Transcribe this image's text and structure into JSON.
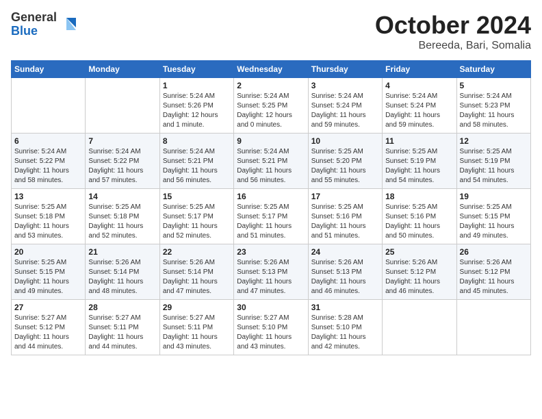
{
  "header": {
    "logo": {
      "general": "General",
      "blue": "Blue"
    },
    "title": "October 2024",
    "subtitle": "Bereeda, Bari, Somalia"
  },
  "weekdays": [
    "Sunday",
    "Monday",
    "Tuesday",
    "Wednesday",
    "Thursday",
    "Friday",
    "Saturday"
  ],
  "weeks": [
    [
      {
        "day": "",
        "info": ""
      },
      {
        "day": "",
        "info": ""
      },
      {
        "day": "1",
        "info": "Sunrise: 5:24 AM\nSunset: 5:26 PM\nDaylight: 12 hours\nand 1 minute."
      },
      {
        "day": "2",
        "info": "Sunrise: 5:24 AM\nSunset: 5:25 PM\nDaylight: 12 hours\nand 0 minutes."
      },
      {
        "day": "3",
        "info": "Sunrise: 5:24 AM\nSunset: 5:24 PM\nDaylight: 11 hours\nand 59 minutes."
      },
      {
        "day": "4",
        "info": "Sunrise: 5:24 AM\nSunset: 5:24 PM\nDaylight: 11 hours\nand 59 minutes."
      },
      {
        "day": "5",
        "info": "Sunrise: 5:24 AM\nSunset: 5:23 PM\nDaylight: 11 hours\nand 58 minutes."
      }
    ],
    [
      {
        "day": "6",
        "info": "Sunrise: 5:24 AM\nSunset: 5:22 PM\nDaylight: 11 hours\nand 58 minutes."
      },
      {
        "day": "7",
        "info": "Sunrise: 5:24 AM\nSunset: 5:22 PM\nDaylight: 11 hours\nand 57 minutes."
      },
      {
        "day": "8",
        "info": "Sunrise: 5:24 AM\nSunset: 5:21 PM\nDaylight: 11 hours\nand 56 minutes."
      },
      {
        "day": "9",
        "info": "Sunrise: 5:24 AM\nSunset: 5:21 PM\nDaylight: 11 hours\nand 56 minutes."
      },
      {
        "day": "10",
        "info": "Sunrise: 5:25 AM\nSunset: 5:20 PM\nDaylight: 11 hours\nand 55 minutes."
      },
      {
        "day": "11",
        "info": "Sunrise: 5:25 AM\nSunset: 5:19 PM\nDaylight: 11 hours\nand 54 minutes."
      },
      {
        "day": "12",
        "info": "Sunrise: 5:25 AM\nSunset: 5:19 PM\nDaylight: 11 hours\nand 54 minutes."
      }
    ],
    [
      {
        "day": "13",
        "info": "Sunrise: 5:25 AM\nSunset: 5:18 PM\nDaylight: 11 hours\nand 53 minutes."
      },
      {
        "day": "14",
        "info": "Sunrise: 5:25 AM\nSunset: 5:18 PM\nDaylight: 11 hours\nand 52 minutes."
      },
      {
        "day": "15",
        "info": "Sunrise: 5:25 AM\nSunset: 5:17 PM\nDaylight: 11 hours\nand 52 minutes."
      },
      {
        "day": "16",
        "info": "Sunrise: 5:25 AM\nSunset: 5:17 PM\nDaylight: 11 hours\nand 51 minutes."
      },
      {
        "day": "17",
        "info": "Sunrise: 5:25 AM\nSunset: 5:16 PM\nDaylight: 11 hours\nand 51 minutes."
      },
      {
        "day": "18",
        "info": "Sunrise: 5:25 AM\nSunset: 5:16 PM\nDaylight: 11 hours\nand 50 minutes."
      },
      {
        "day": "19",
        "info": "Sunrise: 5:25 AM\nSunset: 5:15 PM\nDaylight: 11 hours\nand 49 minutes."
      }
    ],
    [
      {
        "day": "20",
        "info": "Sunrise: 5:25 AM\nSunset: 5:15 PM\nDaylight: 11 hours\nand 49 minutes."
      },
      {
        "day": "21",
        "info": "Sunrise: 5:26 AM\nSunset: 5:14 PM\nDaylight: 11 hours\nand 48 minutes."
      },
      {
        "day": "22",
        "info": "Sunrise: 5:26 AM\nSunset: 5:14 PM\nDaylight: 11 hours\nand 47 minutes."
      },
      {
        "day": "23",
        "info": "Sunrise: 5:26 AM\nSunset: 5:13 PM\nDaylight: 11 hours\nand 47 minutes."
      },
      {
        "day": "24",
        "info": "Sunrise: 5:26 AM\nSunset: 5:13 PM\nDaylight: 11 hours\nand 46 minutes."
      },
      {
        "day": "25",
        "info": "Sunrise: 5:26 AM\nSunset: 5:12 PM\nDaylight: 11 hours\nand 46 minutes."
      },
      {
        "day": "26",
        "info": "Sunrise: 5:26 AM\nSunset: 5:12 PM\nDaylight: 11 hours\nand 45 minutes."
      }
    ],
    [
      {
        "day": "27",
        "info": "Sunrise: 5:27 AM\nSunset: 5:12 PM\nDaylight: 11 hours\nand 44 minutes."
      },
      {
        "day": "28",
        "info": "Sunrise: 5:27 AM\nSunset: 5:11 PM\nDaylight: 11 hours\nand 44 minutes."
      },
      {
        "day": "29",
        "info": "Sunrise: 5:27 AM\nSunset: 5:11 PM\nDaylight: 11 hours\nand 43 minutes."
      },
      {
        "day": "30",
        "info": "Sunrise: 5:27 AM\nSunset: 5:10 PM\nDaylight: 11 hours\nand 43 minutes."
      },
      {
        "day": "31",
        "info": "Sunrise: 5:28 AM\nSunset: 5:10 PM\nDaylight: 11 hours\nand 42 minutes."
      },
      {
        "day": "",
        "info": ""
      },
      {
        "day": "",
        "info": ""
      }
    ]
  ]
}
